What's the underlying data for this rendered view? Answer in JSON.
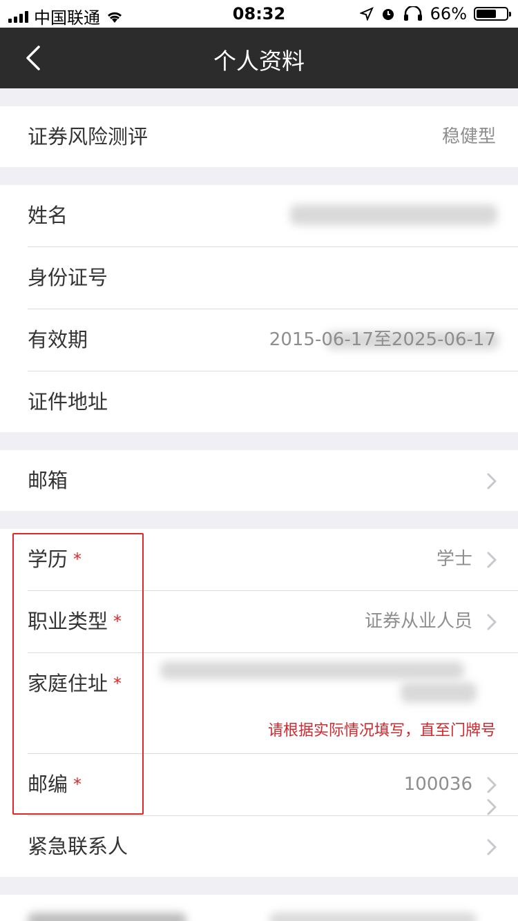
{
  "status_bar": {
    "carrier": "中国联通",
    "time": "08:32",
    "battery": "66%"
  },
  "header": {
    "title": "个人资料"
  },
  "risk": {
    "label": "证券风险测评",
    "value": "稳健型"
  },
  "identity": {
    "name_label": "姓名",
    "id_label": "身份证号",
    "validity_label": "有效期",
    "validity_value": "2015-06-17至2025-06-17",
    "address_label": "证件地址"
  },
  "email": {
    "label": "邮箱"
  },
  "details": {
    "education_label": "学历",
    "education_value": "学士",
    "occupation_label": "职业类型",
    "occupation_value": "证券从业人员",
    "home_label": "家庭住址",
    "home_hint": "请根据实际情况填写，直至门牌号",
    "zip_label": "邮编",
    "zip_value": "100036",
    "emergency_label": "紧急联系人",
    "required_mark": "*"
  },
  "colors": {
    "nav_bg": "#2c2c2c",
    "accent_red": "#e02828"
  }
}
